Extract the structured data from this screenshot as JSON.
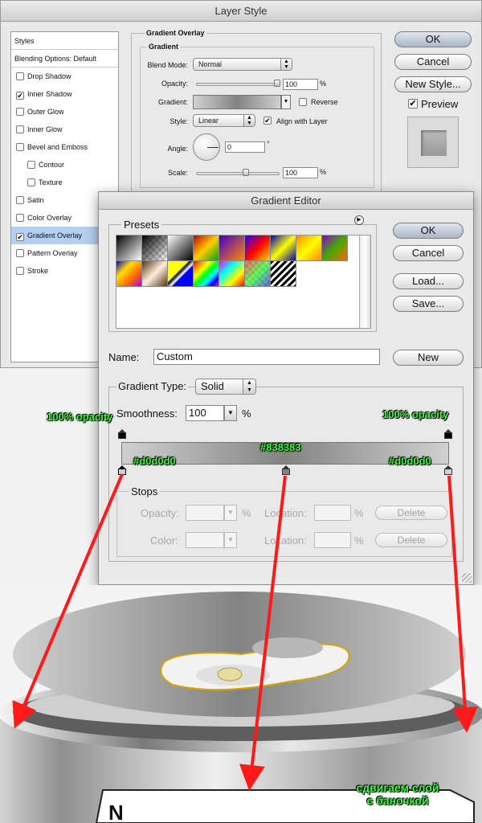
{
  "layer_style": {
    "title": "Layer Style",
    "styles_header": "Styles",
    "blending_options": "Blending Options: Default",
    "items": [
      {
        "label": "Drop Shadow",
        "checked": false
      },
      {
        "label": "Inner Shadow",
        "checked": true
      },
      {
        "label": "Outer Glow",
        "checked": false
      },
      {
        "label": "Inner Glow",
        "checked": false
      },
      {
        "label": "Bevel and Emboss",
        "checked": false
      },
      {
        "label": "Contour",
        "checked": false
      },
      {
        "label": "Texture",
        "checked": false
      },
      {
        "label": "Satin",
        "checked": false
      },
      {
        "label": "Color Overlay",
        "checked": false
      },
      {
        "label": "Gradient Overlay",
        "checked": true
      },
      {
        "label": "Pattern Overlay",
        "checked": false
      },
      {
        "label": "Stroke",
        "checked": false
      }
    ],
    "group_title": "Gradient Overlay",
    "subgroup_title": "Gradient",
    "blend_mode_label": "Blend Mode:",
    "blend_mode_value": "Normal",
    "opacity_label": "Opacity:",
    "opacity_value": "100",
    "percent": "%",
    "gradient_label": "Gradient:",
    "reverse_label": "Reverse",
    "style_label": "Style:",
    "style_value": "Linear",
    "align_label": "Align with Layer",
    "angle_label": "Angle:",
    "angle_value": "0",
    "degree": "°",
    "scale_label": "Scale:",
    "scale_value": "100",
    "ok": "OK",
    "cancel": "Cancel",
    "new_style": "New Style...",
    "preview": "Preview"
  },
  "gradient_editor": {
    "title": "Gradient Editor",
    "presets_label": "Presets",
    "ok": "OK",
    "cancel": "Cancel",
    "load": "Load...",
    "save": "Save...",
    "name_label": "Name:",
    "name_value": "Custom",
    "new": "New",
    "gradient_type_label": "Gradient Type:",
    "gradient_type_value": "Solid",
    "smoothness_label": "Smoothness:",
    "smoothness_value": "100",
    "percent": "%",
    "stops_label": "Stops",
    "opacity_label": "Opacity:",
    "location_label": "Location:",
    "color_label": "Color:",
    "delete": "Delete",
    "colors": {
      "stop_left": "#d0d0d0",
      "stop_mid": "#838383",
      "stop_right": "#d0d0d0"
    }
  },
  "annotations": {
    "opacity_left": "100% opacity",
    "opacity_right": "100% opacity",
    "stop_left": "#d0d0d0",
    "stop_mid": "#838383",
    "stop_right": "#d0d0d0",
    "note_line1": "сдвигаем слой",
    "note_line2": "с баночкой"
  },
  "colors": {
    "annotation_text": "#38ff38",
    "arrow": "#ff1a1a",
    "selection": "#b4cff0"
  }
}
